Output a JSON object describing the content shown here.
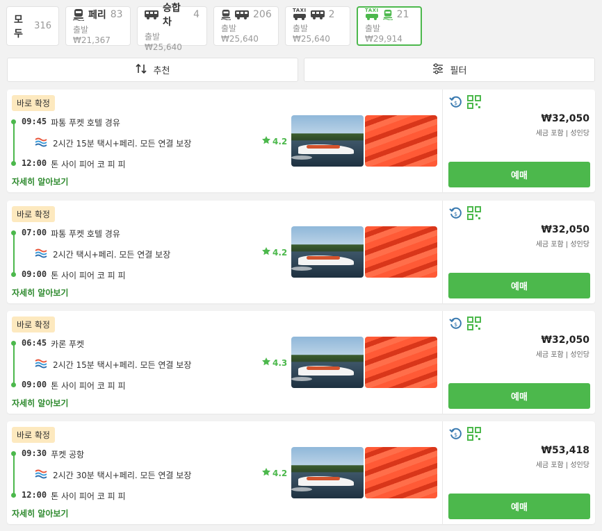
{
  "tabs": {
    "all": {
      "label": "모두",
      "count": "316"
    },
    "ferry": {
      "label": "페리",
      "count": "83",
      "sub": "출발 ₩21,367"
    },
    "van": {
      "label": "승합차",
      "count": "4",
      "sub": "출발 ₩25,640"
    },
    "ferry_van": {
      "count": "206",
      "sub": "출발 ₩25,640"
    },
    "taxi_van": {
      "count": "2",
      "sub": "출발 ₩25,640",
      "taxi_text": "TAXI"
    },
    "taxi_ferry": {
      "count": "21",
      "sub": "출발 ₩29,914",
      "taxi_text": "TAXI"
    }
  },
  "sort": {
    "recommend": "추천",
    "filter": "필터"
  },
  "colors": {
    "accent": "#4cb84c",
    "badge_bg": "#fde9bf"
  },
  "results": [
    {
      "badge": "바로 확정",
      "dep_time": "09:45",
      "dep_place": "파통 푸켓 호텔 경유",
      "duration": "2시간 15분 택시+페리. 모든 연결 보장",
      "rating": "4.2",
      "arr_time": "12:00",
      "arr_place": "톤 사이 피어 코 피 피",
      "more": "자세히 알아보기",
      "price": "₩32,050",
      "tax": "세금 포함 | 성인당",
      "book": "예매"
    },
    {
      "badge": "바로 확정",
      "dep_time": "07:00",
      "dep_place": "파통 푸켓 호텔 경유",
      "duration": "2시간 택시+페리. 모든 연결 보장",
      "rating": "4.2",
      "arr_time": "09:00",
      "arr_place": "톤 사이 피어 코 피 피",
      "more": "자세히 알아보기",
      "price": "₩32,050",
      "tax": "세금 포함 | 성인당",
      "book": "예매"
    },
    {
      "badge": "바로 확정",
      "dep_time": "06:45",
      "dep_place": "카론 푸켓",
      "duration": "2시간 15분 택시+페리. 모든 연결 보장",
      "rating": "4.3",
      "arr_time": "09:00",
      "arr_place": "톤 사이 피어 코 피 피",
      "more": "자세히 알아보기",
      "price": "₩32,050",
      "tax": "세금 포함 | 성인당",
      "book": "예매"
    },
    {
      "badge": "바로 확정",
      "dep_time": "09:30",
      "dep_place": "푸켓 공항",
      "duration": "2시간 30분 택시+페리. 모든 연결 보장",
      "rating": "4.2",
      "arr_time": "12:00",
      "arr_place": "톤 사이 피어 코 피 피",
      "more": "자세히 알아보기",
      "price": "₩53,418",
      "tax": "세금 포함 | 성인당",
      "book": "예매"
    }
  ]
}
